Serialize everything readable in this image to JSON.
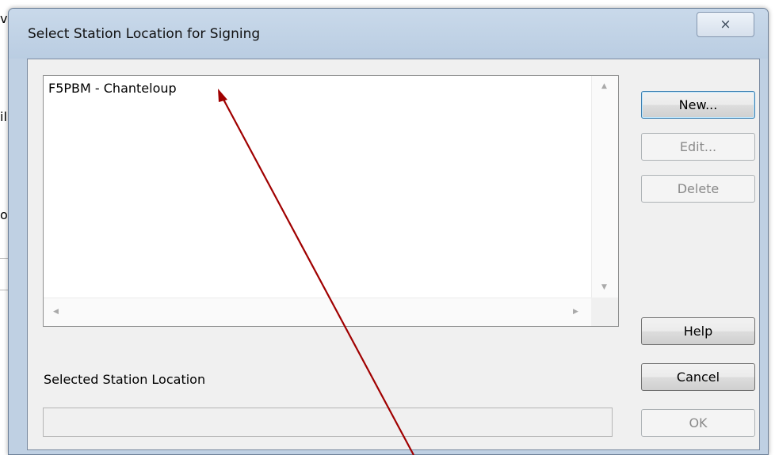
{
  "background_window": {
    "fragment_1": "v",
    "fragment_2": "il",
    "fragment_3": "o"
  },
  "dialog": {
    "title": "Select Station Location for Signing",
    "close_glyph": "⨯"
  },
  "station_list": {
    "items": [
      "F5PBM - Chanteloup"
    ]
  },
  "buttons": {
    "new": "New...",
    "edit": "Edit...",
    "delete": "Delete",
    "help": "Help",
    "cancel": "Cancel",
    "ok": "OK"
  },
  "selected_station": {
    "label": "Selected Station Location",
    "value": ""
  },
  "annotation": {
    "arrow_color": "#a00000"
  }
}
